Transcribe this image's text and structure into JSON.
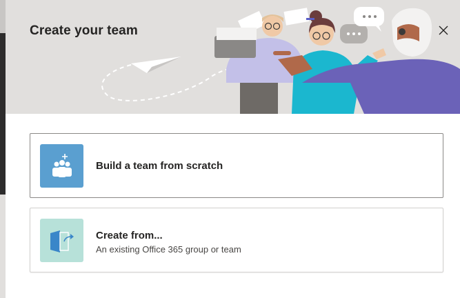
{
  "dialog": {
    "title": "Create your team",
    "close_icon": "close-icon"
  },
  "options": [
    {
      "label": "Build a team from scratch",
      "subtitle": "",
      "icon": "people-add-icon",
      "tile_color": "#5a9fd0"
    },
    {
      "label": "Create from...",
      "subtitle": "An existing Office 365 group or team",
      "icon": "door-arrow-icon",
      "tile_color": "#b7e1d9"
    }
  ],
  "colors": {
    "header_bg": "#e1dfdd",
    "backdrop": "#3b3a39",
    "text": "#252423"
  }
}
